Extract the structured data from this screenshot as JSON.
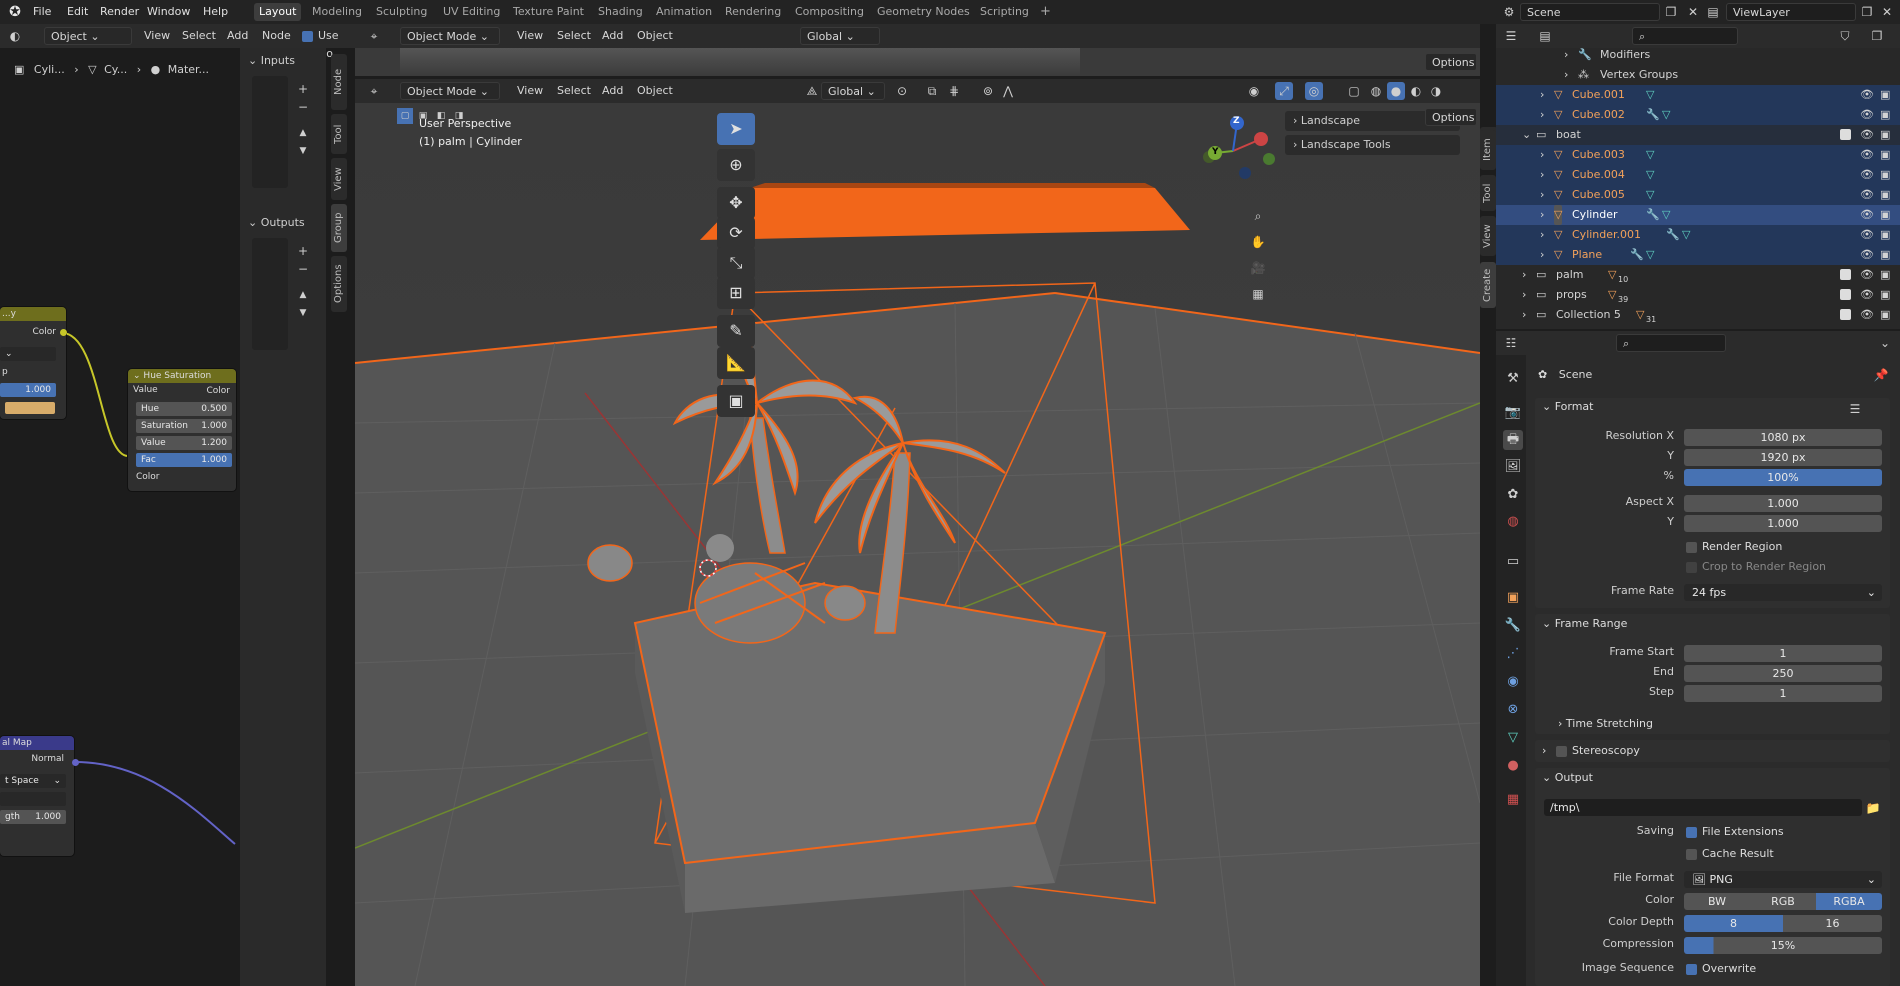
{
  "menu": {
    "items": [
      "File",
      "Edit",
      "Render",
      "Window",
      "Help"
    ],
    "workspaces": [
      "Layout",
      "Modeling",
      "Sculpting",
      "UV Editing",
      "Texture Paint",
      "Shading",
      "Animation",
      "Rendering",
      "Compositing",
      "Geometry Nodes",
      "Scripting"
    ],
    "active_workspace": "Layout",
    "add_tab": "+",
    "scene_name": "Scene",
    "view_layer": "ViewLayer"
  },
  "node_editor": {
    "mode": "Object",
    "menus": [
      "View",
      "Select",
      "Add",
      "Node"
    ],
    "use_nodes": "Use No",
    "breadcrumb": [
      "Cyli...",
      "Cy...",
      "Mater..."
    ],
    "side_tabs": [
      "Node",
      "Tool",
      "View",
      "Group",
      "Options"
    ],
    "inputs_label": "Inputs",
    "outputs_label": "Outputs",
    "partial_node_a": {
      "title": "...y",
      "socket": "Color",
      "row": "p",
      "value": "1.000"
    },
    "hsv_node": {
      "title": "Hue Saturation Value",
      "out_socket": "Color",
      "fields": [
        {
          "label": "Hue",
          "value": "0.500"
        },
        {
          "label": "Saturation",
          "value": "1.000"
        },
        {
          "label": "Value",
          "value": "1.200"
        },
        {
          "label": "Fac",
          "value": "1.000"
        }
      ],
      "in_socket": "Color"
    },
    "partial_node_b": {
      "title": "al Map",
      "socket": "Normal",
      "space": "t Space",
      "strength_label": "gth",
      "strength": "1.000"
    }
  },
  "viewport": {
    "mode": "Object Mode",
    "menus": [
      "View",
      "Select",
      "Add",
      "Object"
    ],
    "orientation": "Global",
    "options": "Options",
    "info_line1": "User Perspective",
    "info_line2": "(1) palm | Cylinder",
    "n_panels": [
      "Landscape",
      "Landscape Tools"
    ],
    "side_tabs": [
      "Item",
      "Tool",
      "View",
      "Create"
    ],
    "gizmo": {
      "x": "X",
      "y": "Y",
      "z": "Z"
    }
  },
  "outliner": {
    "rows": [
      {
        "label": "Modifiers",
        "kind": "sub"
      },
      {
        "label": "Vertex Groups",
        "kind": "sub"
      },
      {
        "label": "Cube.001",
        "kind": "obj",
        "state": "sel"
      },
      {
        "label": "Cube.002",
        "kind": "obj",
        "state": "sel"
      },
      {
        "label": "boat",
        "kind": "coll",
        "state": "sel"
      },
      {
        "label": "Cube.003",
        "kind": "obj",
        "state": "sel"
      },
      {
        "label": "Cube.004",
        "kind": "obj",
        "state": "sel"
      },
      {
        "label": "Cube.005",
        "kind": "obj",
        "state": "sel"
      },
      {
        "label": "Cylinder",
        "kind": "obj",
        "state": "active"
      },
      {
        "label": "Cylinder.001",
        "kind": "obj",
        "state": "sel"
      },
      {
        "label": "Plane",
        "kind": "obj",
        "state": "sel"
      },
      {
        "label": "palm",
        "kind": "coll",
        "count": "10"
      },
      {
        "label": "props",
        "kind": "coll",
        "count": "39"
      },
      {
        "label": "Collection 5",
        "kind": "coll",
        "count": "31"
      }
    ]
  },
  "properties": {
    "scene_label": "Scene",
    "format": {
      "header": "Format",
      "resolution_x_label": "Resolution X",
      "resolution_x": "1080 px",
      "resolution_y_label": "Y",
      "resolution_y": "1920 px",
      "percent_label": "%",
      "percent": "100%",
      "aspect_x_label": "Aspect X",
      "aspect_x": "1.000",
      "aspect_y_label": "Y",
      "aspect_y": "1.000",
      "render_region": "Render Region",
      "crop_region": "Crop to Render Region",
      "frame_rate_label": "Frame Rate",
      "frame_rate": "24 fps"
    },
    "frame_range": {
      "header": "Frame Range",
      "start_label": "Frame Start",
      "start": "1",
      "end_label": "End",
      "end": "250",
      "step_label": "Step",
      "step": "1",
      "time_stretching": "Time Stretching"
    },
    "stereoscopy": "Stereoscopy",
    "output": {
      "header": "Output",
      "path": "/tmp\\",
      "saving_label": "Saving",
      "file_extensions": "File Extensions",
      "cache_result": "Cache Result",
      "file_format_label": "File Format",
      "file_format": "PNG",
      "color_label": "Color",
      "color_options": [
        "BW",
        "RGB",
        "RGBA"
      ],
      "color_selected": "RGBA",
      "depth_label": "Color Depth",
      "depth_options": [
        "8",
        "16"
      ],
      "depth_selected": "8",
      "compression_label": "Compression",
      "compression": "15%",
      "image_sequence_label": "Image Sequence",
      "overwrite": "Overwrite"
    }
  },
  "colors": {
    "selection_orange": "#f2661a",
    "active_blue": "#4772b3",
    "outliner_sel": "#23375a"
  }
}
